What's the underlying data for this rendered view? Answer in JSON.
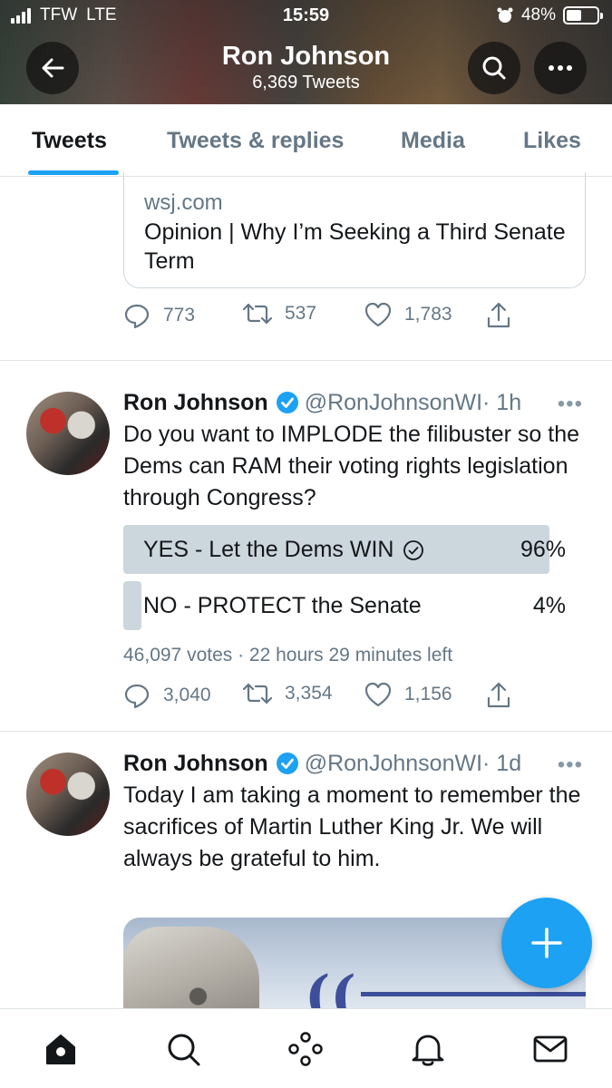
{
  "status_bar": {
    "carrier": "TFW",
    "network": "LTE",
    "time": "15:59",
    "battery": "48%"
  },
  "header": {
    "title": "Ron Johnson",
    "subtitle": "6,369 Tweets"
  },
  "tabs": [
    {
      "label": "Tweets",
      "active": true
    },
    {
      "label": "Tweets & replies",
      "active": false
    },
    {
      "label": "Media",
      "active": false
    },
    {
      "label": "Likes",
      "active": false
    }
  ],
  "link_card": {
    "domain": "wsj.com",
    "title": "Opinion | Why I’m Seeking a Third Senate Term"
  },
  "tweet0_actions": {
    "replies": "773",
    "retweets": "537",
    "likes": "1,783"
  },
  "tweets": [
    {
      "name": "Ron Johnson",
      "handle": "@RonJohnsonWI",
      "time": "· 1h",
      "more": "•••",
      "text": "Do you want to IMPLODE the filibuster so the Dems can RAM their voting rights legislation through Congress?",
      "poll": {
        "options": [
          {
            "label": "YES - Let the Dems WIN",
            "percent": "96%",
            "share": 0.96,
            "selected": true
          },
          {
            "label": "NO - PROTECT the Senate",
            "percent": "4%",
            "share": 0.04,
            "selected": false
          }
        ],
        "votes": "46,097 votes",
        "time_left": "· 22 hours 29 minutes left"
      },
      "actions": {
        "replies": "3,040",
        "retweets": "3,354",
        "likes": "1,156"
      }
    },
    {
      "name": "Ron Johnson",
      "handle": "@RonJohnsonWI",
      "time": "· 1d",
      "more": "•••",
      "text": "Today I am taking a moment to remember the sacrifices of Martin Luther King Jr. We will always be grateful to him."
    }
  ],
  "colors": {
    "accent": "#1da1f2",
    "poll_bar": "#ccd6dd",
    "secondary_text": "#657786"
  },
  "icons": {
    "back": "arrow-left-icon",
    "search": "search-icon",
    "more": "more-icon",
    "reply": "reply-icon",
    "retweet": "retweet-icon",
    "like": "heart-icon",
    "share": "share-icon",
    "verified": "verified-badge-icon",
    "compose": "plus-icon",
    "nav": [
      "home-icon",
      "explore-icon",
      "spaces-icon",
      "notifications-icon",
      "messages-icon"
    ]
  }
}
